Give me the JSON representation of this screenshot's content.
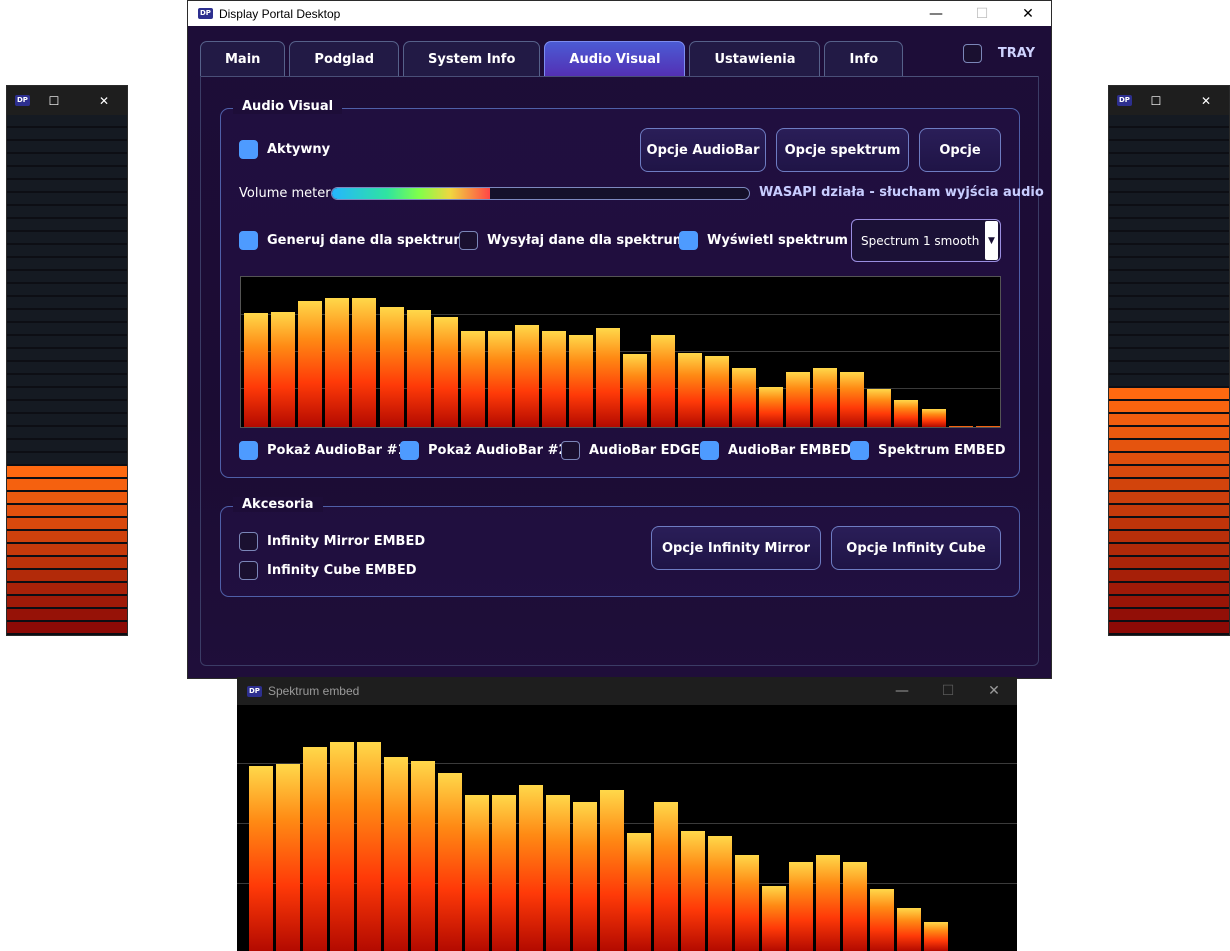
{
  "main_window": {
    "title": "Display Portal Desktop",
    "app_badge": "DP",
    "tabs": [
      {
        "label": "Main",
        "active": false
      },
      {
        "label": "Podglad",
        "active": false
      },
      {
        "label": "System Info",
        "active": false
      },
      {
        "label": "Audio Visual",
        "active": true
      },
      {
        "label": "Ustawienia",
        "active": false
      },
      {
        "label": "Info",
        "active": false
      }
    ],
    "tray": {
      "label": "TRAY",
      "checked": false
    }
  },
  "audio_visual": {
    "group_title": "Audio Visual",
    "active_checkbox": {
      "label": "Aktywny",
      "checked": true
    },
    "buttons": {
      "audiobar_options": "Opcje AudioBar",
      "spectrum_options": "Opcje spektrum",
      "options": "Opcje"
    },
    "volume_meter": {
      "label": "Volume meter",
      "level": 0.38,
      "status": "WASAPI działa - słucham wyjścia audio"
    },
    "spectrum_checkboxes": [
      {
        "label": "Generuj dane dla spektrum",
        "checked": true
      },
      {
        "label": "Wysyłaj dane dla spektrum",
        "checked": false
      },
      {
        "label": "Wyświetl spektrum",
        "checked": true
      }
    ],
    "spectrum_mode": {
      "selected": "Spectrum 1 smooth"
    },
    "spectrum_values": [
      0.77,
      0.78,
      0.85,
      0.87,
      0.87,
      0.81,
      0.79,
      0.74,
      0.65,
      0.65,
      0.69,
      0.65,
      0.62,
      0.67,
      0.49,
      0.62,
      0.5,
      0.48,
      0.4,
      0.27,
      0.37,
      0.4,
      0.37,
      0.26,
      0.18,
      0.12,
      0.01,
      0.01
    ],
    "bottom_checkboxes": [
      {
        "label": "Pokaż AudioBar #1",
        "checked": true
      },
      {
        "label": "Pokaż AudioBar #2",
        "checked": true
      },
      {
        "label": "AudioBar EDGE",
        "checked": false
      },
      {
        "label": "AudioBar EMBED",
        "checked": true
      },
      {
        "label": "Spektrum EMBED",
        "checked": true
      }
    ]
  },
  "accessories": {
    "group_title": "Akcesoria",
    "checkboxes": [
      {
        "label": "Infinity Mirror EMBED",
        "checked": false
      },
      {
        "label": "Infinity Cube EMBED",
        "checked": false
      }
    ],
    "buttons": {
      "mirror_options": "Opcje Infinity Mirror",
      "cube_options": "Opcje Infinity Cube"
    }
  },
  "left_meter": {
    "badge": "DP",
    "level": 0.33
  },
  "right_meter": {
    "badge": "DP",
    "level": 0.48
  },
  "embed_window": {
    "title": "Spektrum embed",
    "badge": "DP",
    "spectrum_values": [
      0.77,
      0.78,
      0.85,
      0.87,
      0.87,
      0.81,
      0.79,
      0.74,
      0.65,
      0.65,
      0.69,
      0.65,
      0.62,
      0.67,
      0.49,
      0.62,
      0.5,
      0.48,
      0.4,
      0.27,
      0.37,
      0.4,
      0.37,
      0.26,
      0.18,
      0.12
    ]
  },
  "colors": {
    "accent": "#4e9bff",
    "tab_active": "#5330b4",
    "window_bg": "#1c0d33",
    "meter_lit_top": "#ff6a10",
    "meter_lit_bottom": "#8a0a06",
    "meter_unlit": "#151a22"
  }
}
